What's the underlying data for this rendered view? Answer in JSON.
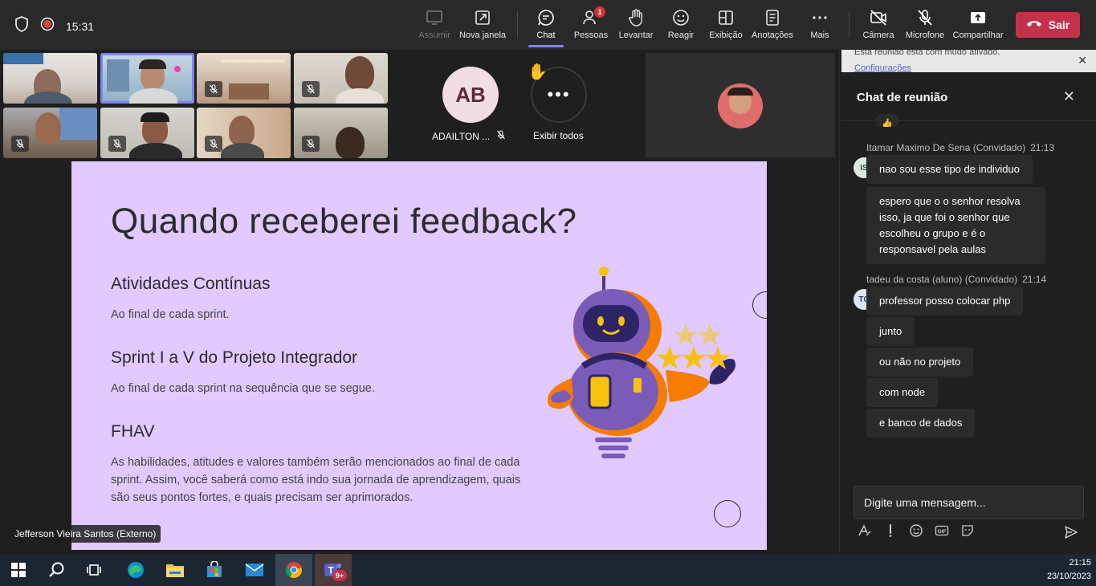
{
  "top_bar": {
    "time": "15:31",
    "buttons": {
      "share_content": "Assumir",
      "new_window": "Nova janela",
      "chat": "Chat",
      "people": "Pessoas",
      "people_badge": "1",
      "raise_hand": "Levantar",
      "react": "Reagir",
      "view": "Exibição",
      "notes": "Anotações",
      "more": "Mais",
      "camera": "Câmera",
      "microphone": "Microfone",
      "share": "Compartilhar",
      "leave": "Sair"
    }
  },
  "participants": {
    "avatar_initials": "AB",
    "avatar_name": "ADAILTON ...",
    "show_all": "Exibir todos"
  },
  "slide": {
    "title": "Quando receberei feedback?",
    "sections": [
      {
        "heading": "Atividades Contínuas",
        "text": "Ao final de cada sprint."
      },
      {
        "heading": "Sprint I a V do Projeto Integrador",
        "text": "Ao final de cada sprint na sequência que se segue."
      },
      {
        "heading": "FHAV",
        "text": "As habilidades, atitudes e valores também serão mencionados ao final de cada sprint. Assim, você saberá como está indo sua jornada de aprendizagem, quais são seus pontos fortes, e quais precisam ser aprimorados."
      }
    ],
    "presenter_tag": "Jefferson Vieira Santos (Externo)"
  },
  "chat": {
    "notice_line1": "Esta reunião está com mudo ativado.",
    "notice_link": "Configurações",
    "title": "Chat de reunião",
    "groups": [
      {
        "sender": "Itamar Maximo De Sena (Convidado)",
        "time": "21:13",
        "initials": "IS",
        "messages": [
          "nao sou esse tipo de individuo",
          "espero que o o senhor resolva isso, ja que foi o senhor que escolheu o grupo e é o responsavel pela aulas"
        ]
      },
      {
        "sender": "tadeu da costa (aluno) (Convidado)",
        "time": "21:14",
        "initials": "TC",
        "messages": [
          "professor posso colocar php",
          "junto",
          "ou não no projeto",
          "com node",
          "e banco de dados"
        ]
      }
    ],
    "compose_placeholder": "Digite uma mensagem..."
  },
  "taskbar": {
    "teams_badge": "9+",
    "clock_time": "21:15",
    "clock_date": "23/10/2023"
  }
}
